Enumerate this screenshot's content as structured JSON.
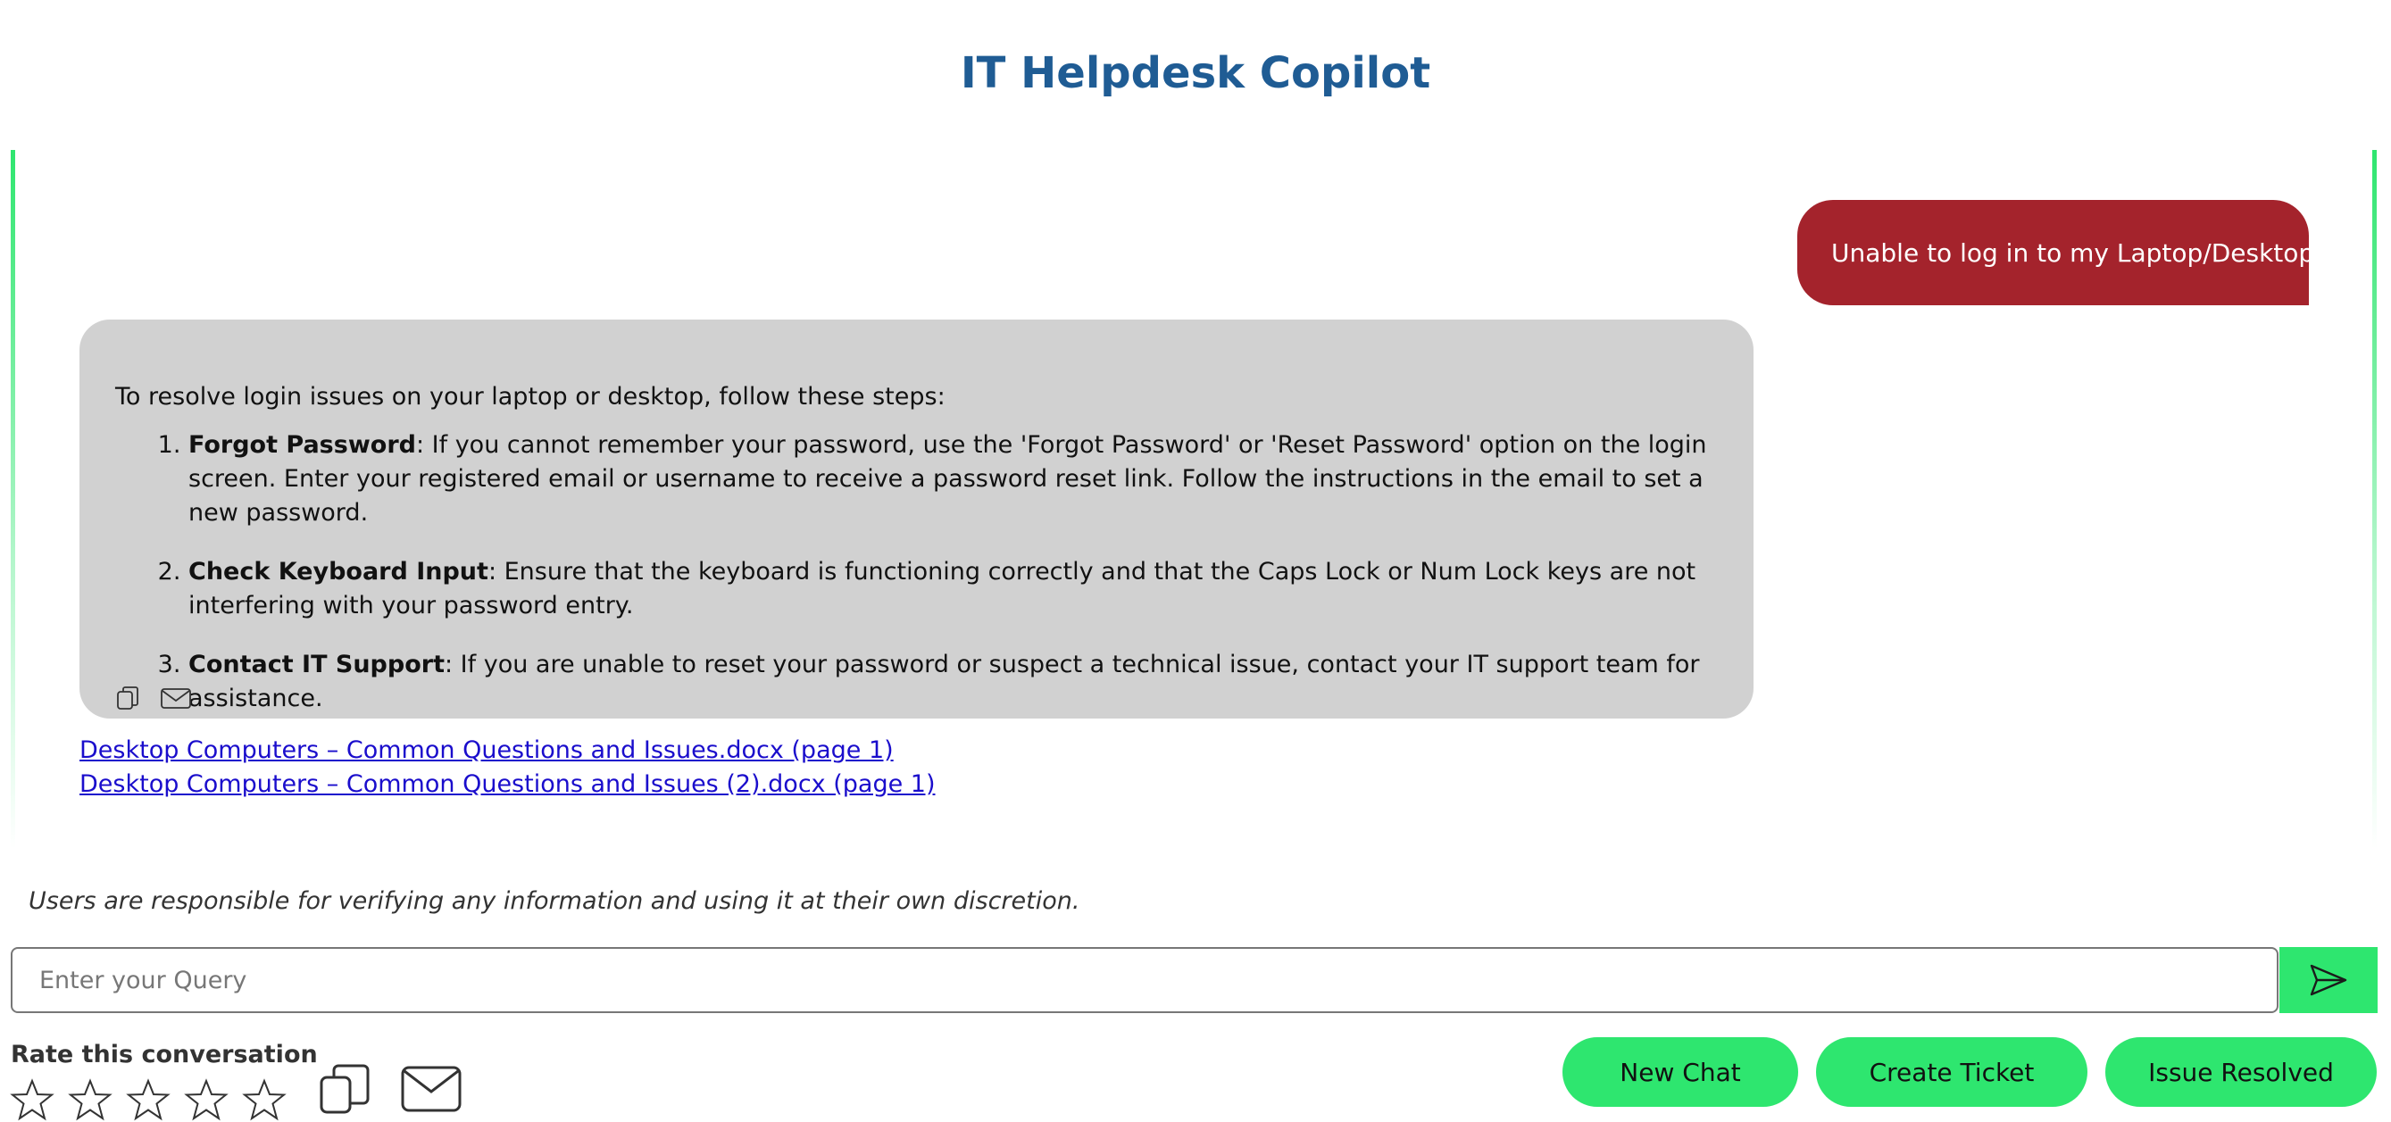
{
  "header": {
    "title": "IT Helpdesk Copilot"
  },
  "chat": {
    "user_message": "Unable to log in to my Laptop/Desktop",
    "bot_intro": "To resolve login issues on your laptop or desktop, follow these steps:",
    "steps": [
      {
        "title": "Forgot Password",
        "text": ": If you cannot remember your password, use the 'Forgot Password' or 'Reset Password' option on the login screen. Enter your registered email or username to receive a password reset link. Follow the instructions in the email to set a new password."
      },
      {
        "title": "Check Keyboard Input",
        "text": ": Ensure that the keyboard is functioning correctly and that the Caps Lock or Num Lock keys are not interfering with your password entry."
      },
      {
        "title": "Contact IT Support",
        "text": ": If you are unable to reset your password or suspect a technical issue, contact your IT support team for assistance."
      }
    ],
    "bubble_icons": [
      "copy-icon",
      "mail-icon"
    ],
    "sources": [
      "Desktop Computers – Common Questions and Issues.docx (page 1)",
      "Desktop Computers – Common Questions and Issues (2).docx (page 1)"
    ]
  },
  "disclaimer": "Users are responsible for verifying any information and using it at their own discretion.",
  "input": {
    "placeholder": "Enter your Query",
    "value": ""
  },
  "send_icon": "send-icon",
  "rating": {
    "label": "Rate this conversation",
    "max_stars": 5,
    "selected": 0
  },
  "footer_icons": [
    "copy-icon",
    "mail-icon"
  ],
  "buttons": {
    "new_chat": "New Chat",
    "create_ticket": "Create Ticket",
    "issue_resolved": "Issue Resolved"
  },
  "colors": {
    "title": "#1f5c94",
    "user_bubble": "#a4232c",
    "bot_bubble": "#d1d1d1",
    "accent_green": "#2ee66f",
    "link": "#1a0dcc"
  }
}
